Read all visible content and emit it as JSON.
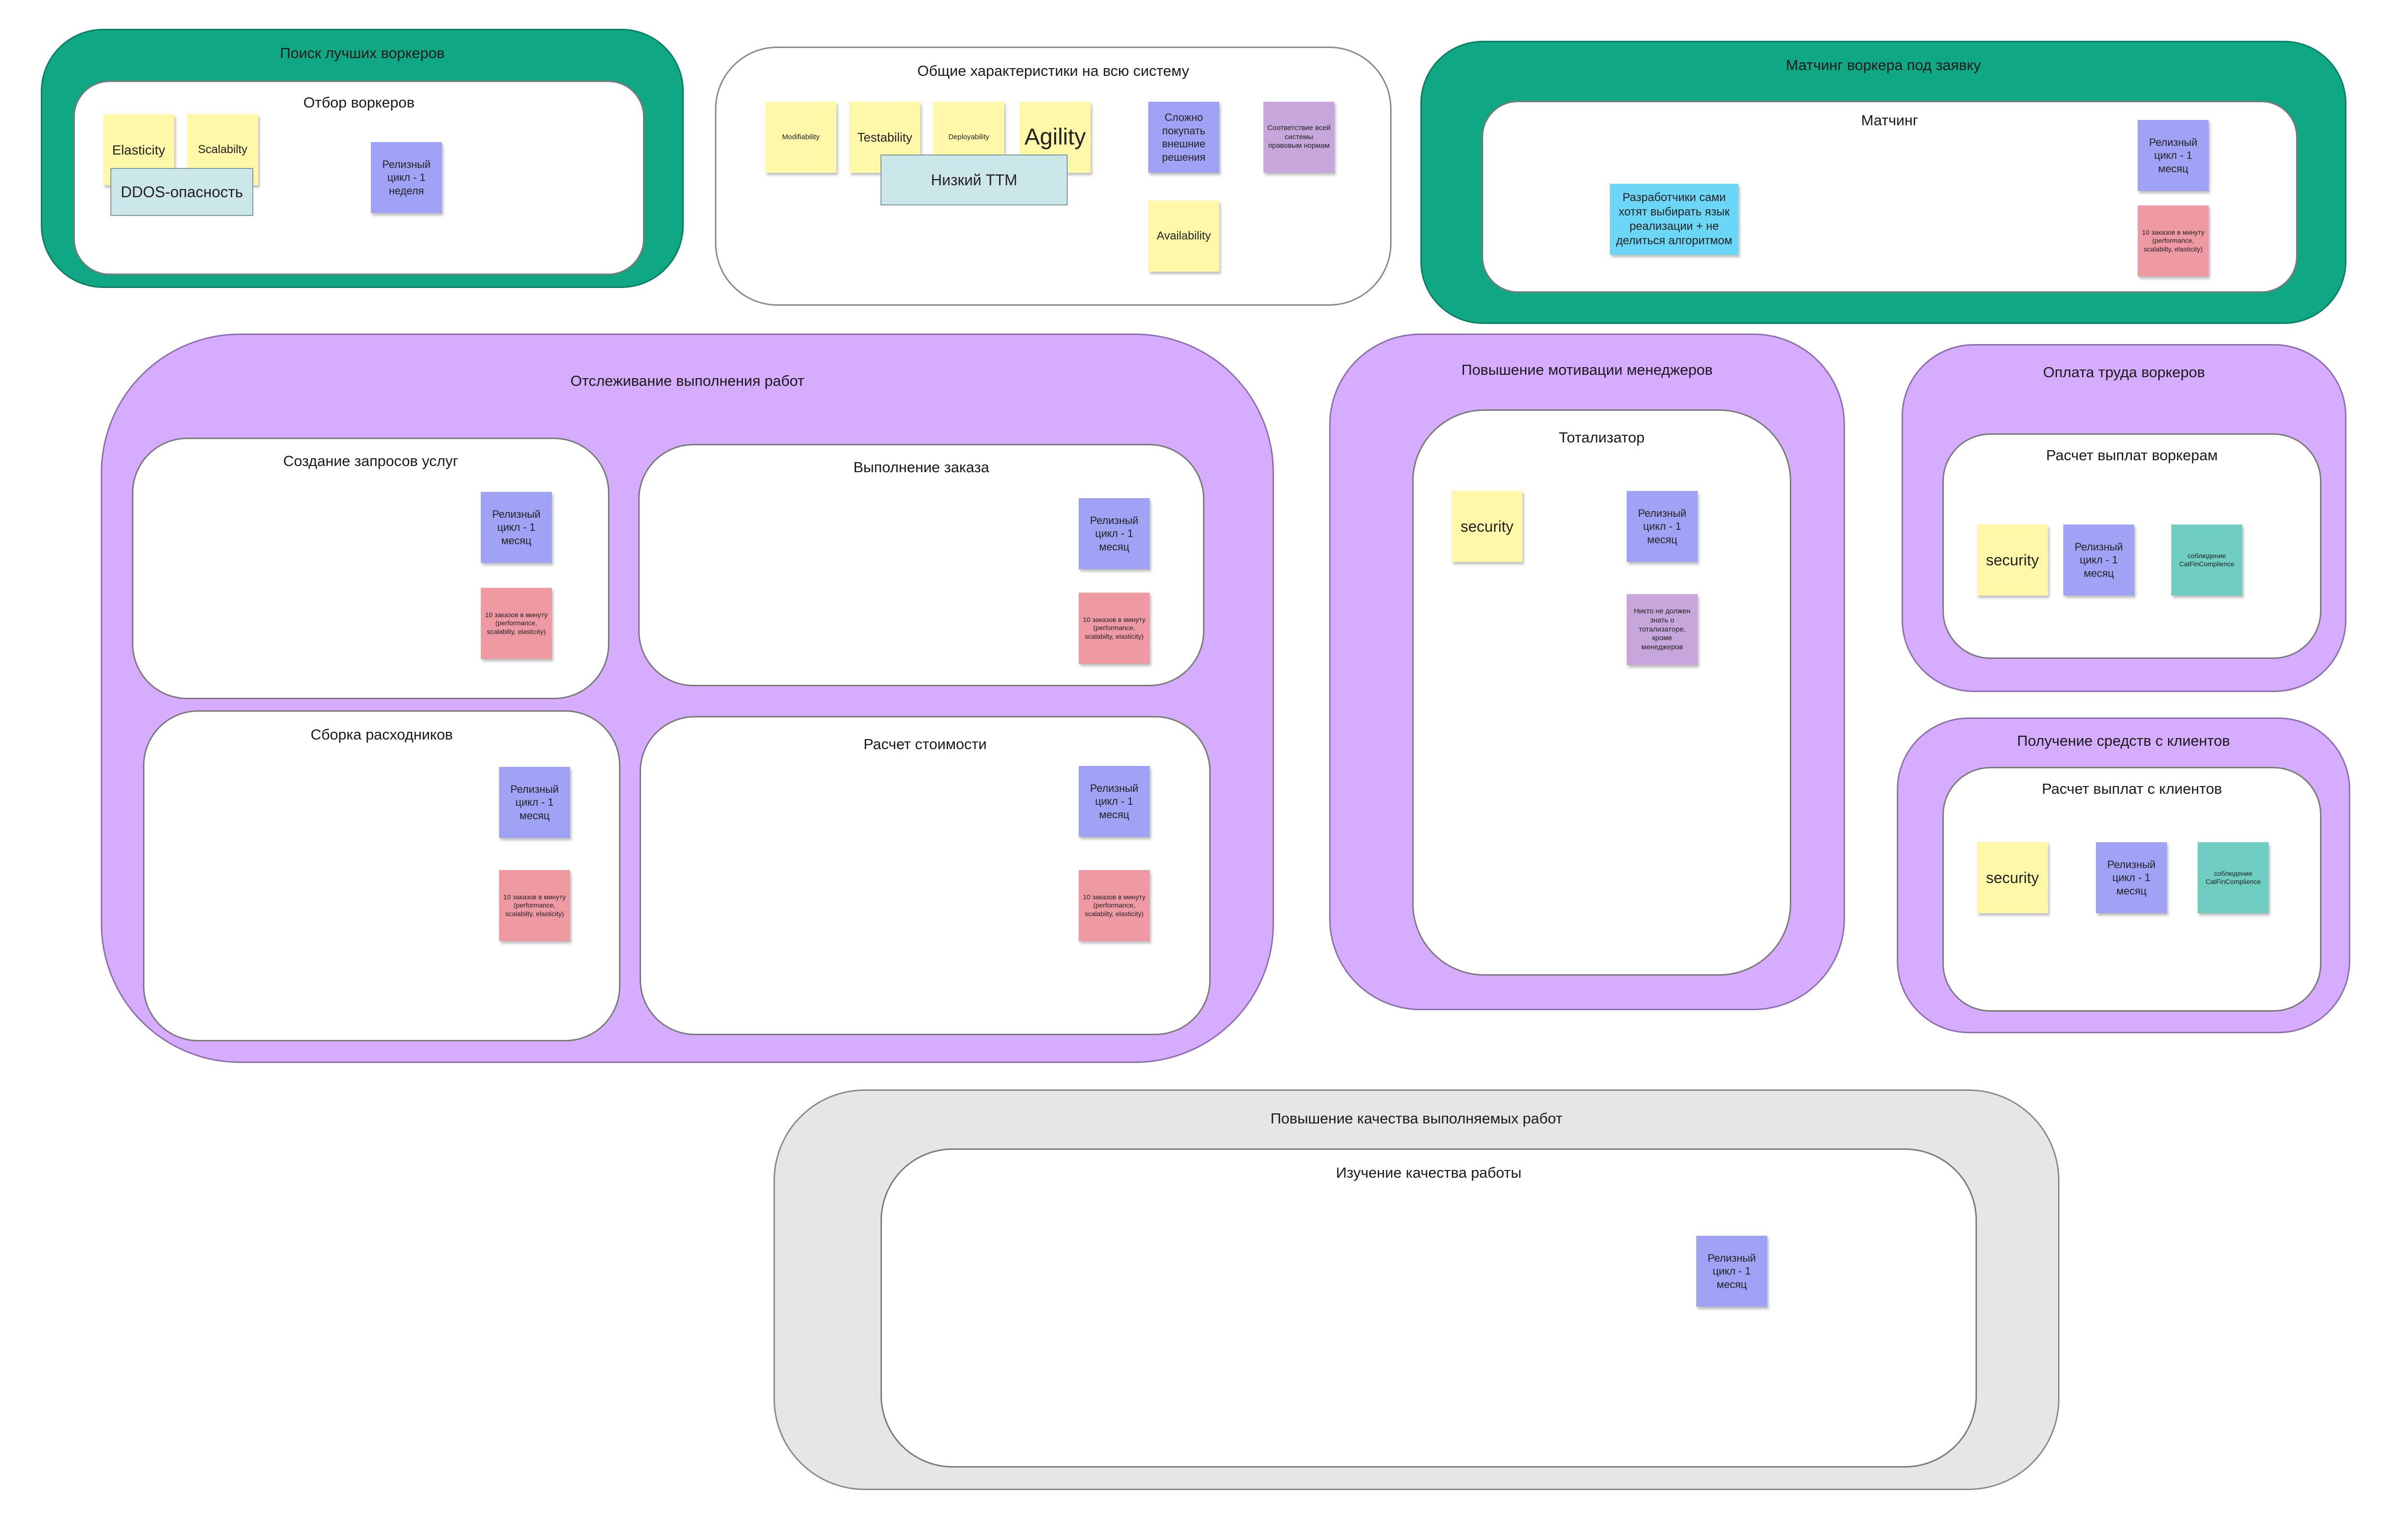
{
  "zones": {
    "search_workers": {
      "title": "Поиск лучших воркеров"
    },
    "selection": {
      "title": "Отбор воркеров"
    },
    "general": {
      "title": "Общие характеристики на всю систему"
    },
    "matching_outer": {
      "title": "Матчинг воркера под заявку"
    },
    "matching_inner": {
      "title": "Матчинг"
    },
    "tracking": {
      "title": "Отслеживание выполнения работ"
    },
    "create_requests": {
      "title": "Создание запросов услуг"
    },
    "order_exec": {
      "title": "Выполнение заказа"
    },
    "consumables": {
      "title": "Сборка расходников"
    },
    "cost_calc": {
      "title": "Расчет стоимости"
    },
    "manager_motivation": {
      "title": "Повышение мотивации менеджеров"
    },
    "totalizator": {
      "title": "Тотализатор"
    },
    "worker_payment": {
      "title": "Оплата труда воркеров"
    },
    "worker_payouts": {
      "title": "Расчет выплат воркерам"
    },
    "client_funds": {
      "title": "Получение средств с клиентов"
    },
    "client_payouts": {
      "title": "Расчет выплат с клиентов"
    },
    "quality_up": {
      "title": "Повышение качества выполняемых работ"
    },
    "quality_study": {
      "title": "Изучение качества работы"
    }
  },
  "stickies": {
    "elasticity": "Elasticity",
    "scalability": "Scalabilty",
    "ddos": "DDOS-опасность",
    "release_week": "Релизный цикл - 1 неделя",
    "release_month": "Релизный цикл - 1 месяц",
    "modifiability": "Modifiability",
    "testability": "Testability",
    "deployability": "Deployability",
    "agility": "Agility",
    "low_ttm": "Низкий TTM",
    "hard_buy": "Сложно покупать внешние решения",
    "legal": "Соответствие всей системы правовым нормам",
    "availability": "Availability",
    "devs_choose": "Разработчики сами хотят выбирать язык реализации + не делиться алгоритмом",
    "orders_per_min": "10 заказов в минуту (performance, scalabilty, elasticity)",
    "security": "security",
    "nobody_knows": "Никто не должен знать о тотализаторе, кроме менеджеров",
    "compliance": "соблюдение CatFinComplience"
  },
  "colors": {
    "green_zone": "#0fa784",
    "purple_zone": "#d5acff",
    "grey_zone": "#e6e6e6",
    "sticky_yellow": "#fff8a8",
    "sticky_blue": "#a0a3f5",
    "sticky_red": "#ef9aa3",
    "sticky_purple": "#c7a6dc",
    "sticky_cyan": "#6bd6f6",
    "sticky_teal": "#6fcdc2"
  }
}
